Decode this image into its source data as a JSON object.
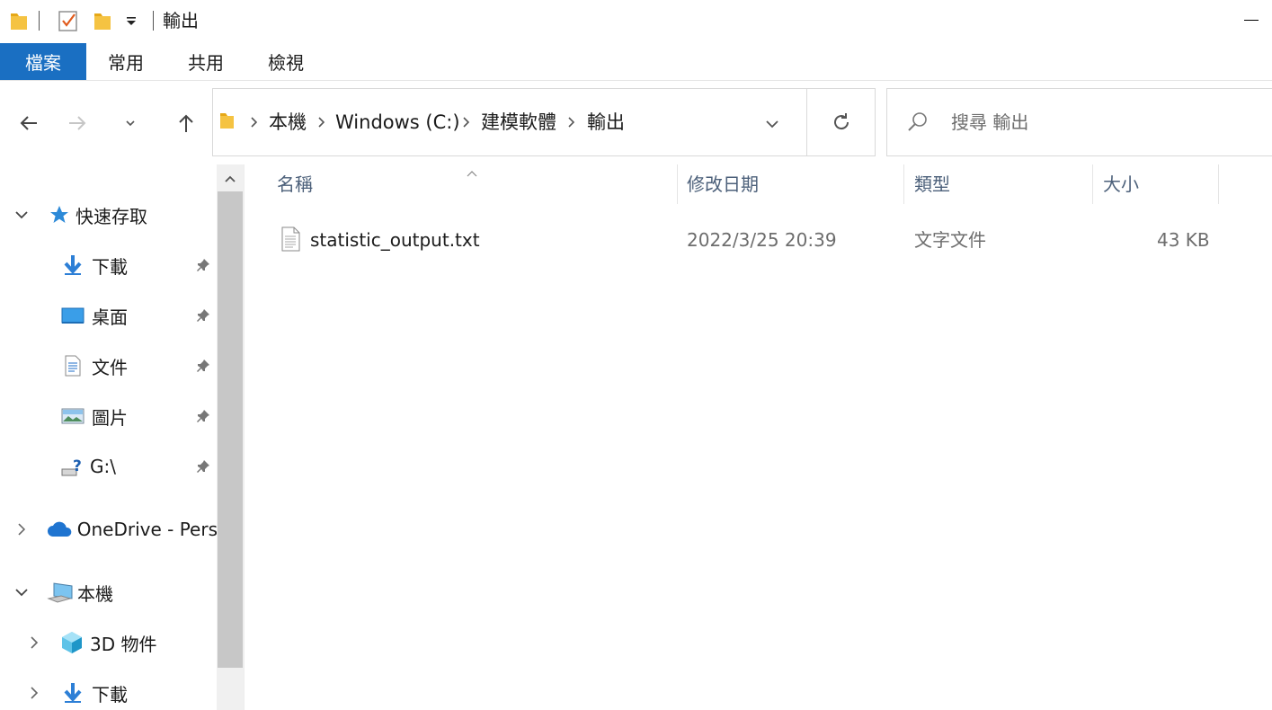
{
  "title_bar": {
    "title": "輸出",
    "icons": [
      "folder-icon",
      "properties-check-icon",
      "new-folder-icon",
      "customize-dropdown-icon"
    ]
  },
  "ribbon": {
    "tabs": [
      {
        "label": "檔案",
        "active": true
      },
      {
        "label": "常用",
        "active": false
      },
      {
        "label": "共用",
        "active": false
      },
      {
        "label": "檢視",
        "active": false
      }
    ]
  },
  "address_bar": {
    "crumbs": [
      "本機",
      "Windows (C:)",
      "建模軟體",
      "輸出"
    ]
  },
  "search": {
    "placeholder": "搜尋 輸出"
  },
  "sidebar": {
    "quick_access": {
      "label": "快速存取"
    },
    "quick_items": [
      {
        "label": "下載",
        "icon": "download-arrow-icon"
      },
      {
        "label": "桌面",
        "icon": "desktop-icon"
      },
      {
        "label": "文件",
        "icon": "documents-icon"
      },
      {
        "label": "圖片",
        "icon": "pictures-icon"
      },
      {
        "label": "G:\\",
        "icon": "unknown-drive-icon"
      }
    ],
    "onedrive": {
      "label": "OneDrive - Pers"
    },
    "this_pc": {
      "label": "本機"
    },
    "pc_items": [
      {
        "label": "3D 物件",
        "icon": "3d-objects-icon"
      },
      {
        "label": "下載",
        "icon": "download-arrow-icon"
      }
    ]
  },
  "file_list": {
    "columns": {
      "name": "名稱",
      "modified": "修改日期",
      "type": "類型",
      "size": "大小"
    },
    "sort_column": "name",
    "rows": [
      {
        "name": "statistic_output.txt",
        "modified": "2022/3/25 20:39",
        "type": "文字文件",
        "size": "43 KB"
      }
    ]
  },
  "colors": {
    "accent": "#1a6fc2",
    "header_text": "#4c607a",
    "folder": "#f5c342"
  }
}
